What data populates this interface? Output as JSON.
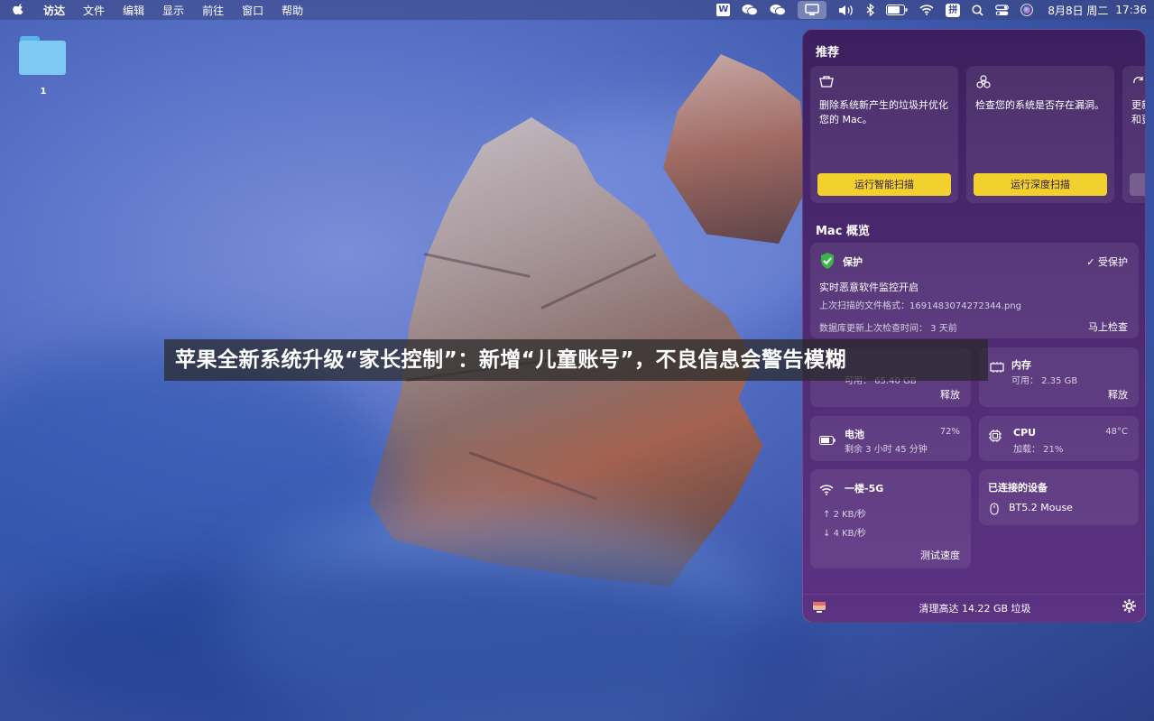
{
  "menubar": {
    "app_name": "访达",
    "menus": [
      "文件",
      "编辑",
      "显示",
      "前往",
      "窗口",
      "帮助"
    ],
    "wps_label": "W",
    "ime_label": "拼",
    "date": "8月8日 周二",
    "time": "17:36",
    "icons": [
      "apple-icon",
      "wps-icon",
      "wechat-icon",
      "wechat-icon",
      "cleaner-icon",
      "volume-icon",
      "bluetooth-icon",
      "battery-icon",
      "wifi-icon",
      "input-method-icon",
      "search-icon",
      "control-center-icon",
      "siri-icon"
    ]
  },
  "desktop": {
    "folder_label": "1"
  },
  "headline": "苹果全新系统升级“家长控制”：新增“儿童账号”，不良信息会警告模糊",
  "panel": {
    "recommend_title": "推荐",
    "recommend_cards": [
      {
        "icon": "trash-icon",
        "text": "删除系统新产生的垃圾并优化您的 Mac。",
        "button": "运行智能扫描"
      },
      {
        "icon": "biohazard-icon",
        "text": "检查您的系统是否存在漏洞。",
        "button": "运行深度扫描"
      },
      {
        "icon": "update-icon",
        "text": "更新和更"
      }
    ],
    "overview_title": "Mac 概览",
    "protection": {
      "title": "保护",
      "status": "受保护",
      "realtime": "实时恶意软件监控开启",
      "last_scan": "上次扫描的文件格式：1691483074272344.png",
      "db_update": "数据库更新上次检查时间：  3 天前",
      "action": "马上检查"
    },
    "storage": {
      "available": "可用：  65.40 GB",
      "action": "释放"
    },
    "memory": {
      "title": "内存",
      "available": "可用：  2.35 GB",
      "action": "释放"
    },
    "battery": {
      "title": "电池",
      "percent": "72%",
      "remaining": "剩余 3 小时 45 分钟"
    },
    "cpu": {
      "title": "CPU",
      "temp": "48°C",
      "load": "加载：  21%"
    },
    "network": {
      "name": "一楼-5G",
      "upload": "2 KB/秒",
      "download": "4 KB/秒",
      "action": "测试速度"
    },
    "devices": {
      "title": "已连接的设备",
      "device": "BT5.2 Mouse"
    },
    "footer": {
      "text": "清理高达 14.22 GB 垃圾"
    }
  }
}
